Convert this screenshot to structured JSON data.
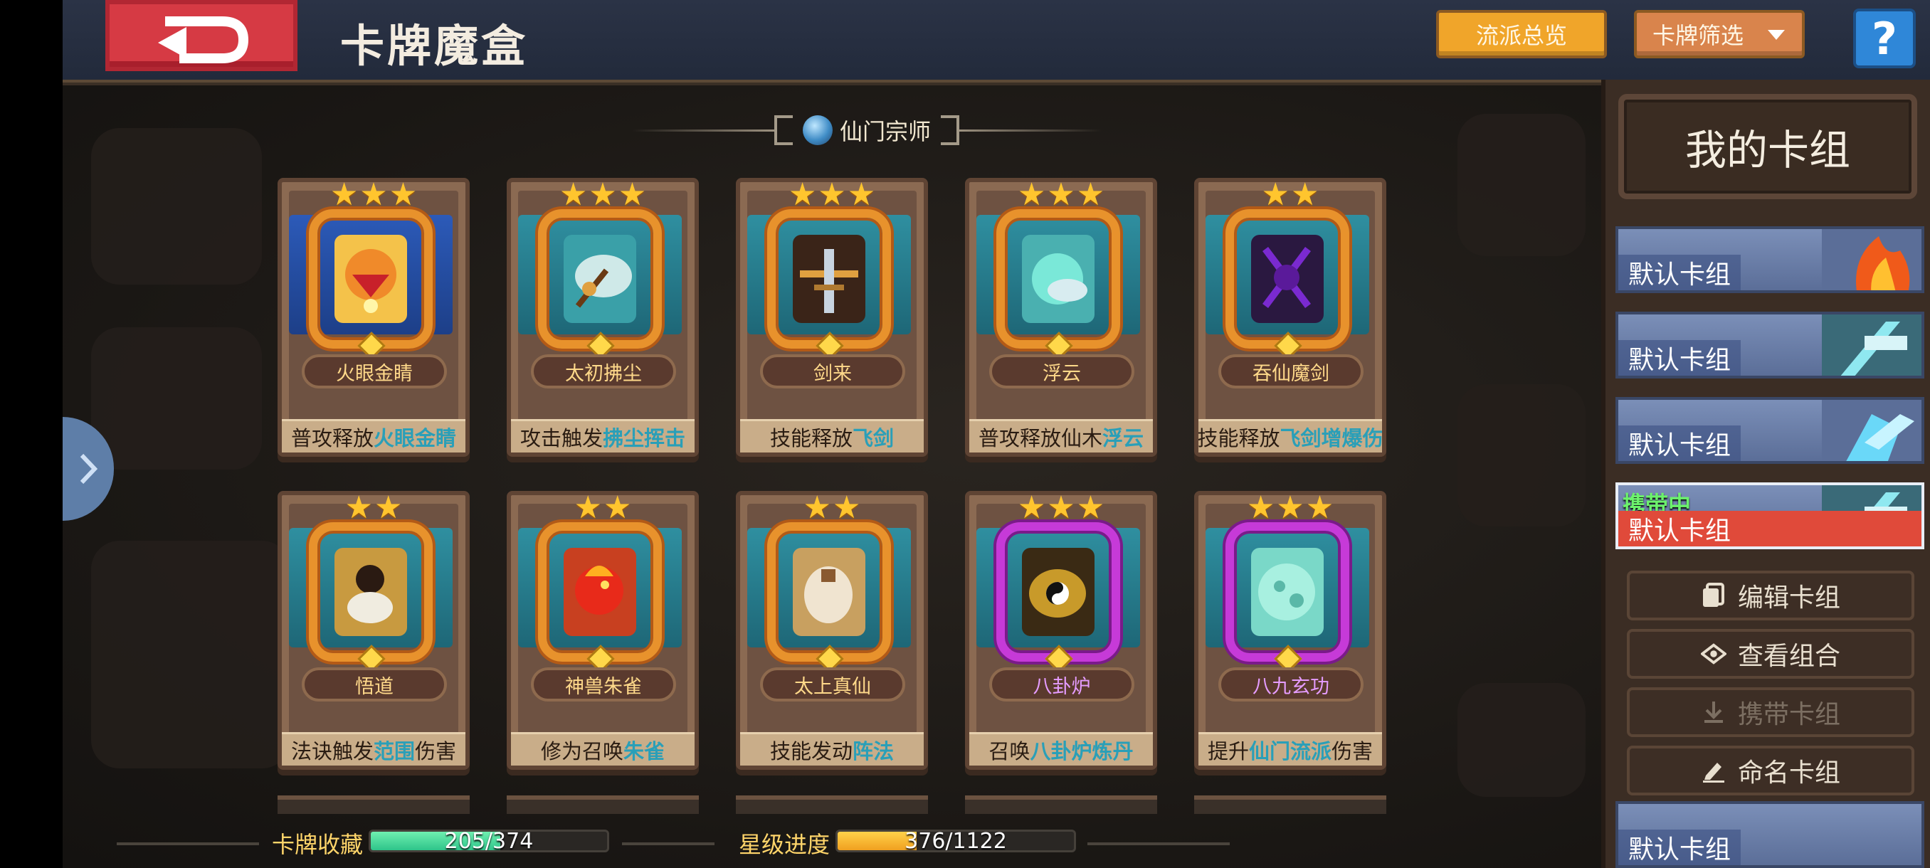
{
  "header": {
    "title": "卡牌魔盒",
    "overview_label": "流派总览",
    "filter_label": "卡牌筛选",
    "help_label": "?"
  },
  "section": {
    "name": "仙门宗师"
  },
  "cards": [
    {
      "name": "火眼金睛",
      "effect_parts": [
        "普攻释放",
        "火眼金睛",
        ""
      ],
      "stars": 3,
      "frame": "orange",
      "bg": "blue"
    },
    {
      "name": "太初拂尘",
      "effect_parts": [
        "攻击触发",
        "拂尘挥击",
        ""
      ],
      "stars": 3,
      "frame": "orange",
      "bg": "teal"
    },
    {
      "name": "剑来",
      "effect_parts": [
        "技能释放",
        "飞剑",
        ""
      ],
      "stars": 3,
      "frame": "orange",
      "bg": "teal"
    },
    {
      "name": "浮云",
      "effect_parts": [
        "普攻释放仙木",
        "浮云",
        ""
      ],
      "stars": 3,
      "frame": "orange",
      "bg": "teal"
    },
    {
      "name": "吞仙魔剑",
      "effect_parts": [
        "技能释放",
        "飞剑增爆伤",
        ""
      ],
      "stars": 2,
      "frame": "orange",
      "bg": "teal"
    },
    {
      "name": "悟道",
      "effect_parts": [
        "法诀触发",
        "范围",
        "伤害"
      ],
      "stars": 2,
      "frame": "orange",
      "bg": "teal"
    },
    {
      "name": "神兽朱雀",
      "effect_parts": [
        "修为召唤",
        "朱雀",
        ""
      ],
      "stars": 2,
      "frame": "orange",
      "bg": "teal"
    },
    {
      "name": "太上真仙",
      "effect_parts": [
        "技能发动",
        "阵法",
        ""
      ],
      "stars": 2,
      "frame": "orange",
      "bg": "teal"
    },
    {
      "name": "八卦炉",
      "effect_parts": [
        "召唤",
        "八卦炉炼丹",
        ""
      ],
      "stars": 3,
      "frame": "purple",
      "bg": "teal"
    },
    {
      "name": "八九玄功",
      "effect_parts": [
        "提升",
        "仙门流派",
        "伤害"
      ],
      "stars": 3,
      "frame": "purple",
      "bg": "teal"
    }
  ],
  "stats": {
    "collection_label": "卡牌收藏",
    "collection_value": "205/374",
    "collection_fraction": 0.548,
    "star_label": "星级进度",
    "star_value": "376/1122",
    "star_fraction": 0.335
  },
  "panel": {
    "title": "我的卡组",
    "decks": [
      {
        "name": "默认卡组",
        "thumb": "fire",
        "active": false
      },
      {
        "name": "默认卡组",
        "thumb": "sword",
        "active": false
      },
      {
        "name": "默认卡组",
        "thumb": "ice",
        "active": false
      },
      {
        "name": "默认卡组",
        "thumb": "sword",
        "active": true,
        "badge": "携带中"
      }
    ],
    "actions": [
      {
        "label": "编辑卡组",
        "icon": "cards-icon",
        "enabled": true
      },
      {
        "label": "查看组合",
        "icon": "eye-icon",
        "enabled": true
      },
      {
        "label": "携带卡组",
        "icon": "download-icon",
        "enabled": false
      },
      {
        "label": "命名卡组",
        "icon": "pencil-icon",
        "enabled": true
      }
    ],
    "bottom_deck": {
      "name": "默认卡组"
    }
  },
  "colors": {
    "accent_orange": "#f0a52a",
    "active_deck": "#e04a3a",
    "highlight_text": "#2a9fb8"
  }
}
